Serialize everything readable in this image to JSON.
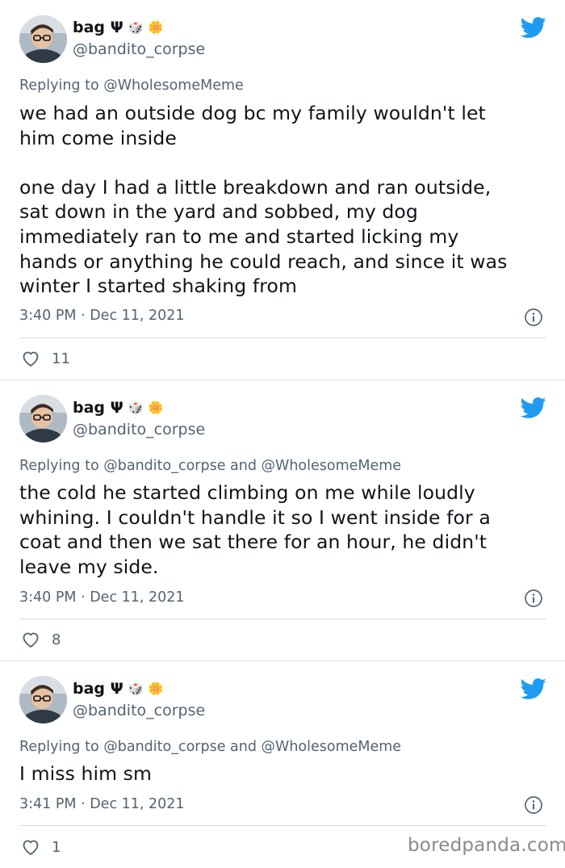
{
  "tweets": [
    {
      "display_name": "bag Ψ",
      "emoji_1": "🎲",
      "emoji_2": "🌼",
      "handle": "@bandito_corpse",
      "replying_prefix": "Replying to ",
      "replying_to": "@WholesomeMeme",
      "replying_and": "",
      "replying_to_2": "",
      "text": "we had an outside dog bc my family wouldn't let\nhim come inside\n\none day I had a little breakdown and ran outside,\nsat down in the yard and sobbed, my dog\nimmediately ran to me and started licking my\nhands or anything he could reach, and since it was\nwinter I started shaking from",
      "time": "3:40 PM · Dec 11, 2021",
      "likes": "11"
    },
    {
      "display_name": "bag Ψ",
      "emoji_1": "🎲",
      "emoji_2": "🌼",
      "handle": "@bandito_corpse",
      "replying_prefix": "Replying to ",
      "replying_to": "@bandito_corpse",
      "replying_and": " and ",
      "replying_to_2": "@WholesomeMeme",
      "text": "the cold he started climbing on me while loudly\nwhining. I couldn't handle it so I went inside for a\ncoat and then we sat there for an hour, he didn't\nleave my side.",
      "time": "3:40 PM · Dec 11, 2021",
      "likes": "8"
    },
    {
      "display_name": "bag Ψ",
      "emoji_1": "🎲",
      "emoji_2": "🌼",
      "handle": "@bandito_corpse",
      "replying_prefix": "Replying to ",
      "replying_to": "@bandito_corpse",
      "replying_and": " and ",
      "replying_to_2": "@WholesomeMeme",
      "text": "I miss him sm",
      "time": "3:41 PM · Dec 11, 2021",
      "likes": "1"
    }
  ],
  "watermark": "boredpanda.com",
  "colors": {
    "twitter_blue": "#1d9bf0",
    "secondary": "#536471"
  },
  "icons": [
    "avatar",
    "twitter-bird-icon",
    "info-icon",
    "heart-icon"
  ]
}
